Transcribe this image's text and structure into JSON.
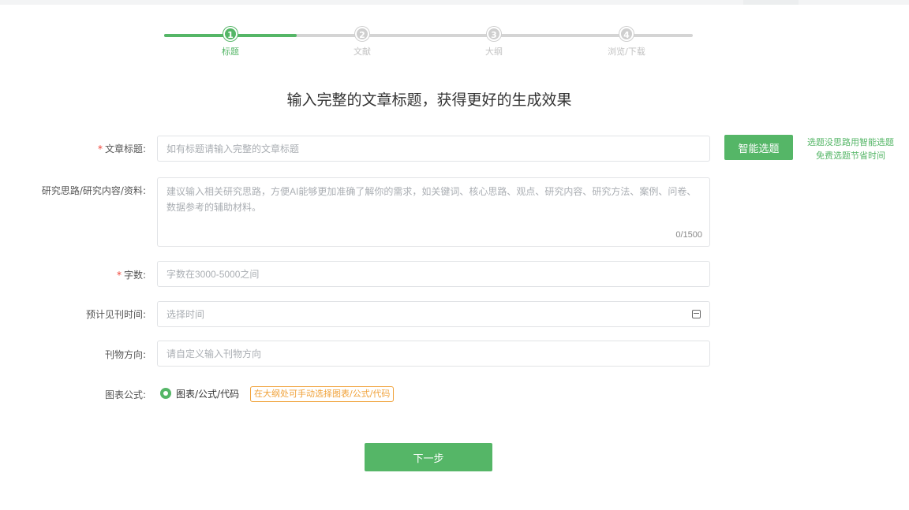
{
  "steps": [
    {
      "num": "1",
      "label": "标题",
      "active": true
    },
    {
      "num": "2",
      "label": "文献",
      "active": false
    },
    {
      "num": "3",
      "label": "大纲",
      "active": false
    },
    {
      "num": "4",
      "label": "浏览/下载",
      "active": false
    }
  ],
  "headline": "输入完整的文章标题，获得更好的生成效果",
  "form": {
    "required_mark": "*",
    "title": {
      "label": "文章标题:",
      "placeholder": "如有标题请输入完整的文章标题"
    },
    "research": {
      "label": "研究思路/研究内容/资料:",
      "placeholder": "建议输入相关研究思路，方便AI能够更加准确了解你的需求，如关键词、核心思路、观点、研究内容、研究方法、案例、问卷、数据参考的辅助材料。",
      "counter": "0/1500"
    },
    "word_count": {
      "label": "字数:",
      "placeholder": "字数在3000-5000之间"
    },
    "publish_time": {
      "label": "预计见刊时间:",
      "placeholder": "选择时间",
      "icon": "calendar-icon"
    },
    "journal": {
      "label": "刊物方向:",
      "placeholder": "请自定义输入刊物方向"
    },
    "chart_formula": {
      "label": "图表公式:",
      "option": "图表/公式/代码",
      "hint": "在大纲处可手动选择图表/公式/代码"
    }
  },
  "smart_topic": {
    "button": "智能选题",
    "tip_line1": "选题没思路用智能选题",
    "tip_line2": "免费选题节省时间"
  },
  "next_button": "下一步",
  "colors": {
    "accent": "#55b667",
    "required": "#f04438",
    "hint": "#f0a23a"
  }
}
